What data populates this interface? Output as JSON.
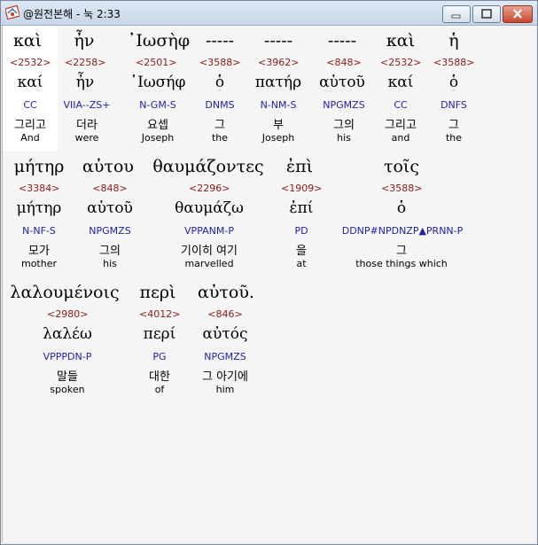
{
  "window": {
    "title": "@원전본해 - 눅 2:33"
  },
  "icons": {
    "app": "bible-app-icon",
    "minimize": "minimize-icon",
    "maximize": "maximize-icon",
    "close": "close-icon"
  },
  "rows": [
    {
      "words": [
        {
          "greek": "καὶ",
          "strong": "<2532>",
          "lemma": "καί",
          "morph": "CC",
          "korean": "그리고",
          "english": "And"
        },
        {
          "greek": "ἦν",
          "strong": "<2258>",
          "lemma": "ἦν",
          "morph": "VIIA--ZS+",
          "korean": "더라",
          "english": "were"
        },
        {
          "greek": "᾽Ιωσὴφ",
          "strong": "<2501>",
          "lemma": "᾽Ιωσήφ",
          "morph": "N-GM-S",
          "korean": "요셉",
          "english": "Joseph"
        },
        {
          "greek": "-----",
          "strong": "<3588>",
          "lemma": "ὁ",
          "morph": "DNMS",
          "korean": "그",
          "english": "the"
        },
        {
          "greek": "-----",
          "strong": "<3962>",
          "lemma": "πατήρ",
          "morph": "N-NM-S",
          "korean": "부",
          "english": "Joseph"
        },
        {
          "greek": "-----",
          "strong": "<848>",
          "lemma": "αὑτοῦ",
          "morph": "NPGMZS",
          "korean": "그의",
          "english": "his"
        },
        {
          "greek": "καὶ",
          "strong": "<2532>",
          "lemma": "καί",
          "morph": "CC",
          "korean": "그리고",
          "english": "and"
        },
        {
          "greek": "ἡ",
          "strong": "<3588>",
          "lemma": "ὁ",
          "morph": "DNFS",
          "korean": "그",
          "english": "the"
        }
      ]
    },
    {
      "words": [
        {
          "greek": "μήτηρ",
          "strong": "<3384>",
          "lemma": "μήτηρ",
          "morph": "N-NF-S",
          "korean": "모가",
          "english": "mother"
        },
        {
          "greek": "αὐτου",
          "strong": "<848>",
          "lemma": "αὑτοῦ",
          "morph": "NPGMZS",
          "korean": "그의",
          "english": "his"
        },
        {
          "greek": "θαυμάζοντες",
          "strong": "<2296>",
          "lemma": "θαυμάζω",
          "morph": "VPPANM-P",
          "korean": "기이히 여기",
          "english": "marvelled"
        },
        {
          "greek": "ἐπὶ",
          "strong": "<1909>",
          "lemma": "ἐπί",
          "morph": "PD",
          "korean": "을",
          "english": "at"
        },
        {
          "greek": "τοῖς",
          "strong": "<3588>",
          "lemma": "ὁ",
          "morph": "DDNP#NPDNZP▲PRNN-P",
          "korean": "그",
          "english": "those things which"
        }
      ]
    },
    {
      "words": [
        {
          "greek": "λαλουμένοις",
          "strong": "<2980>",
          "lemma": "λαλέω",
          "morph": "VPPPDN-P",
          "korean": "말들",
          "english": "spoken"
        },
        {
          "greek": "περὶ",
          "strong": "<4012>",
          "lemma": "περί",
          "morph": "PG",
          "korean": "대한",
          "english": "of"
        },
        {
          "greek": "αὐτοῦ.",
          "strong": "<846>",
          "lemma": "αὐτός",
          "morph": "NPGMZS",
          "korean": "그 아기에",
          "english": "him"
        }
      ]
    }
  ]
}
